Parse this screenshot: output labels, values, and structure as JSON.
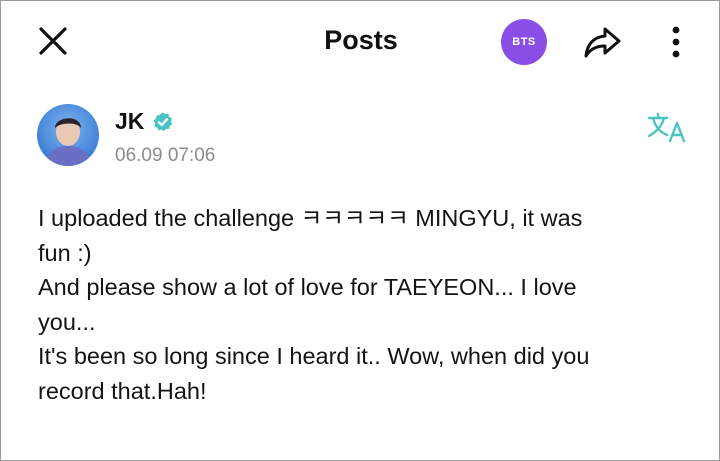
{
  "header": {
    "title": "Posts",
    "community_badge": "BTS",
    "close_icon": "close-icon",
    "share_icon": "share-icon",
    "more_icon": "more-vertical-icon"
  },
  "post": {
    "author": "JK",
    "verified": true,
    "timestamp": "06.09 07:06",
    "lines": [
      "I uploaded the challenge ㅋㅋㅋㅋㅋ MINGYU, it was",
      "fun :)",
      "And please show a lot of love for TAEYEON... I love",
      "you...",
      "It's been so long since I heard it.. Wow, when did you",
      "record that.Hah!"
    ]
  },
  "colors": {
    "accent_purple": "#8a4ee6",
    "teal": "#4cc3c3",
    "timestamp_gray": "#8c8c8c"
  }
}
